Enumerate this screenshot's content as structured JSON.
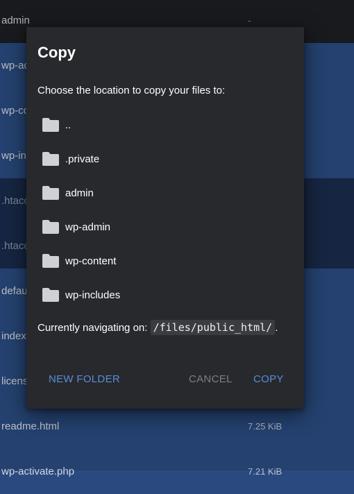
{
  "file_list": [
    {
      "name": "admin",
      "size": "-"
    },
    {
      "name": "wp-admin",
      "size": ""
    },
    {
      "name": "wp-content",
      "size": ""
    },
    {
      "name": "wp-includes",
      "size": ""
    },
    {
      "name": ".htaccess",
      "size": ""
    },
    {
      "name": ".htaccess",
      "size": ""
    },
    {
      "name": "default",
      "size": ""
    },
    {
      "name": "index.php",
      "size": ""
    },
    {
      "name": "license.txt",
      "size": ""
    },
    {
      "name": "readme.html",
      "size": "7.25 KiB"
    },
    {
      "name": "wp-activate.php",
      "size": "7.21 KiB"
    }
  ],
  "dialog": {
    "title": "Copy",
    "prompt": "Choose the location to copy your files to:",
    "folders": [
      {
        "name": "..",
        "icon": "folder-icon"
      },
      {
        "name": ".private",
        "icon": "folder-icon"
      },
      {
        "name": "admin",
        "icon": "folder-icon"
      },
      {
        "name": "wp-admin",
        "icon": "folder-icon"
      },
      {
        "name": "wp-content",
        "icon": "folder-icon"
      },
      {
        "name": "wp-includes",
        "icon": "folder-icon"
      }
    ],
    "navigating_prefix": "Currently navigating on: ",
    "current_path": "/files/public_html/",
    "navigating_suffix": ".",
    "new_folder_label": "NEW FOLDER",
    "cancel_label": "CANCEL",
    "copy_label": "COPY"
  },
  "colors": {
    "accent": "#5b8dd8",
    "dialog_bg": "#27292d",
    "row_blue": "#2a4a7f",
    "row_selected": "#1a2b4b"
  }
}
